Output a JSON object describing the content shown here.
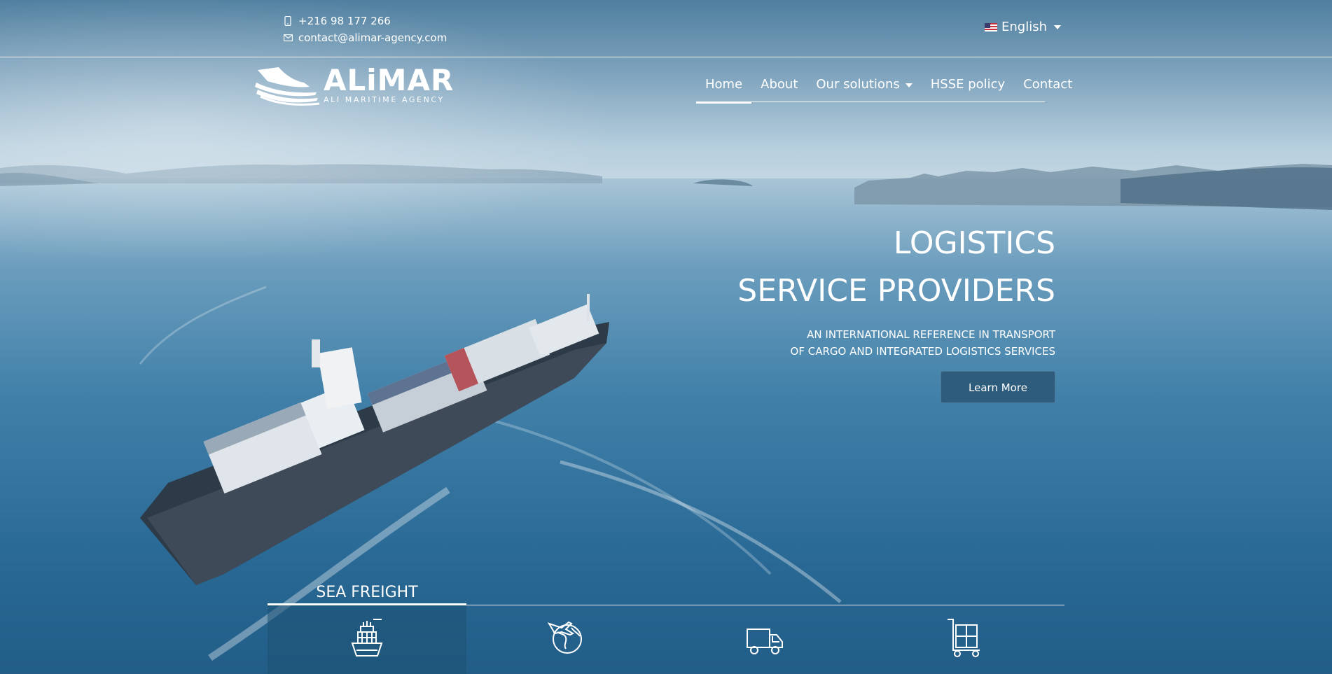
{
  "topbar": {
    "phone": "+216 98 177 266",
    "email": "contact@alimar-agency.com",
    "language": "English"
  },
  "brand": {
    "name": "ALiMAR",
    "tagline": "ALI MARITIME AGENCY"
  },
  "nav": {
    "items": [
      "Home",
      "About",
      "Our solutions",
      "HSSE policy",
      "Contact"
    ],
    "active": "Home"
  },
  "hero": {
    "title_line1": "LOGISTICS",
    "title_line2": "SERVICE PROVIDERS",
    "tagline_line1": "AN INTERNATIONAL REFERENCE IN TRANSPORT",
    "tagline_line2": "OF CARGO AND INTEGRATED LOGISTICS SERVICES",
    "cta": "Learn More"
  },
  "services": {
    "active_title": "SEA FREIGHT",
    "tabs": [
      {
        "icon": "cargo-ship-icon"
      },
      {
        "icon": "globe-plane-icon"
      },
      {
        "icon": "truck-icon"
      },
      {
        "icon": "warehouse-cart-icon"
      }
    ]
  },
  "colors": {
    "button_bg": "#2d5c7d",
    "text": "#ffffff",
    "sea": "#2a6a96"
  }
}
